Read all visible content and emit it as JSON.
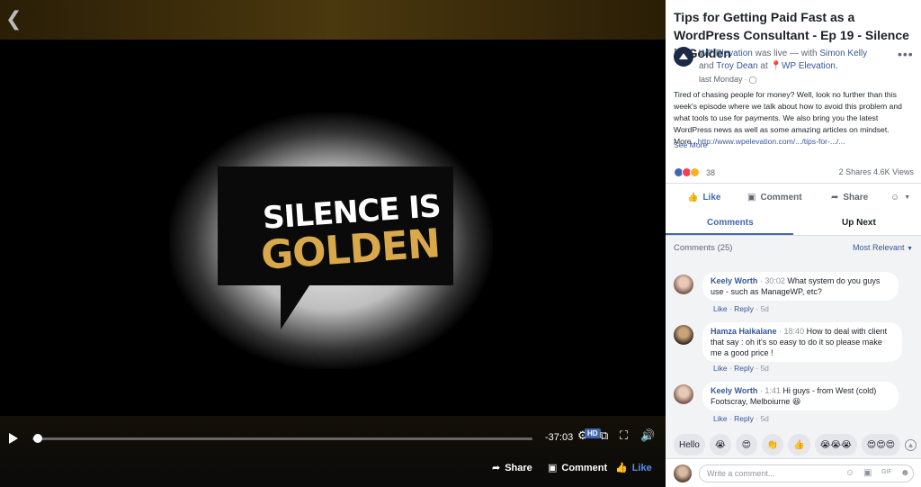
{
  "video": {
    "slide_line1": "SILENCE IS",
    "slide_line2": "GOLDEN",
    "time_remaining": "-37:03",
    "hd_badge": "HD",
    "progress_fraction": 0.01,
    "share_label": "Share",
    "comment_label": "Comment",
    "like_label": "Like"
  },
  "post": {
    "title": "Tips for Getting Paid Fast as a WordPress Consultant - Ep 19 - Silence is Golden",
    "page_name": "WP Elevation",
    "live_text": " was live — with ",
    "person1": "Simon Kelly",
    "and_text": " and ",
    "person2": "Troy Dean",
    "at_text": " at ",
    "location": "WP Elevation.",
    "time": "last Monday",
    "description": "Tired of chasing people for money? Well, look no further than this week's episode where we talk about how to avoid this problem and what tools to use for payments. We also bring you the latest WordPress news as well as some amazing articles on mindset. More...",
    "link": "http://www.wpelevation.com/.../tips-for-.../...",
    "see_more": "See More",
    "reaction_count": "38",
    "stats": "2 Shares  4.6K Views"
  },
  "actions": {
    "like": "Like",
    "comment": "Comment",
    "share": "Share"
  },
  "tabs": {
    "comments": "Comments",
    "up_next": "Up Next"
  },
  "comments": {
    "header": "Comments (25)",
    "sort": "Most Relevant",
    "like": "Like",
    "reply": "Reply",
    "items": [
      {
        "name": "Keely Worth",
        "time": "30:02",
        "text": "What system do you guys use - such as ManageWP, etc?",
        "age": "5d"
      },
      {
        "name": "Hamza Haikalane",
        "time": "18:40",
        "text": "How to deal with client that say : oh it's so easy to do it so please make me a good price !",
        "age": "5d"
      },
      {
        "name": "Keely Worth",
        "time": "1:41",
        "text": "Hi guys - from West (cold) Footscray, Melboiurne 😆",
        "age": "5d"
      }
    ],
    "quick": [
      "Hello",
      "😭",
      "😍",
      "👏",
      "👍",
      "😭😭😭",
      "😍😍😍"
    ],
    "write_placeholder": "Write a comment..."
  },
  "colors": {
    "facebook_blue": "#4267b2",
    "link_blue": "#365899",
    "gold": "#d8a84a"
  }
}
